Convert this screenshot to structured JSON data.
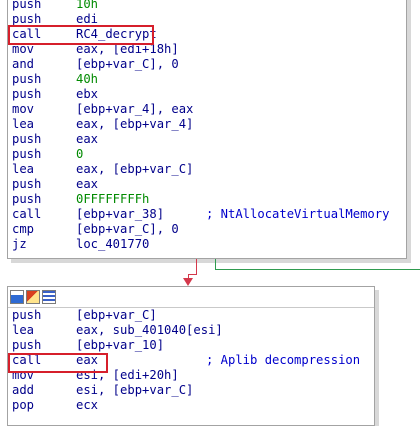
{
  "top_block": {
    "lines": [
      {
        "mnemonic": "push",
        "operand": "10h",
        "comment": ""
      },
      {
        "mnemonic": "push",
        "operand": "edi",
        "comment": ""
      },
      {
        "mnemonic": "call",
        "operand": "RC4_decrypt",
        "comment": ""
      },
      {
        "mnemonic": "mov",
        "operand": "eax, [edi+18h]",
        "comment": ""
      },
      {
        "mnemonic": "and",
        "operand": "[ebp+var_C], 0",
        "comment": ""
      },
      {
        "mnemonic": "push",
        "operand": "40h",
        "comment": ""
      },
      {
        "mnemonic": "push",
        "operand": "ebx",
        "comment": ""
      },
      {
        "mnemonic": "mov",
        "operand": "[ebp+var_4], eax",
        "comment": ""
      },
      {
        "mnemonic": "lea",
        "operand": "eax, [ebp+var_4]",
        "comment": ""
      },
      {
        "mnemonic": "push",
        "operand": "eax",
        "comment": ""
      },
      {
        "mnemonic": "push",
        "operand": "0",
        "comment": ""
      },
      {
        "mnemonic": "lea",
        "operand": "eax, [ebp+var_C]",
        "comment": ""
      },
      {
        "mnemonic": "push",
        "operand": "eax",
        "comment": ""
      },
      {
        "mnemonic": "push",
        "operand": "0FFFFFFFFh",
        "comment": ""
      },
      {
        "mnemonic": "call",
        "operand": "[ebp+var_38]",
        "comment": "; NtAllocateVirtualMemory"
      },
      {
        "mnemonic": "cmp",
        "operand": "[ebp+var_C], 0",
        "comment": ""
      },
      {
        "mnemonic": "jz",
        "operand": "loc_401770",
        "comment": ""
      }
    ]
  },
  "bottom_block": {
    "lines": [
      {
        "mnemonic": "push",
        "operand": "[ebp+var_C]",
        "comment": ""
      },
      {
        "mnemonic": "lea",
        "operand": "eax, sub_401040[esi]",
        "comment": ""
      },
      {
        "mnemonic": "push",
        "operand": "[ebp+var_10]",
        "comment": ""
      },
      {
        "mnemonic": "call",
        "operand": "eax",
        "comment": "; Aplib decompression"
      },
      {
        "mnemonic": "mov",
        "operand": "esi, [edi+20h]",
        "comment": ""
      },
      {
        "mnemonic": "add",
        "operand": "esi, [ebp+var_C]",
        "comment": ""
      },
      {
        "mnemonic": "pop",
        "operand": "ecx",
        "comment": ""
      }
    ]
  },
  "colors": {
    "highlight": "#d61f2b",
    "true_branch": "#2f9b4f",
    "false_branch": "#d4384b"
  },
  "icons": [
    "graph-view-icon",
    "edit-icon",
    "listing-icon"
  ]
}
